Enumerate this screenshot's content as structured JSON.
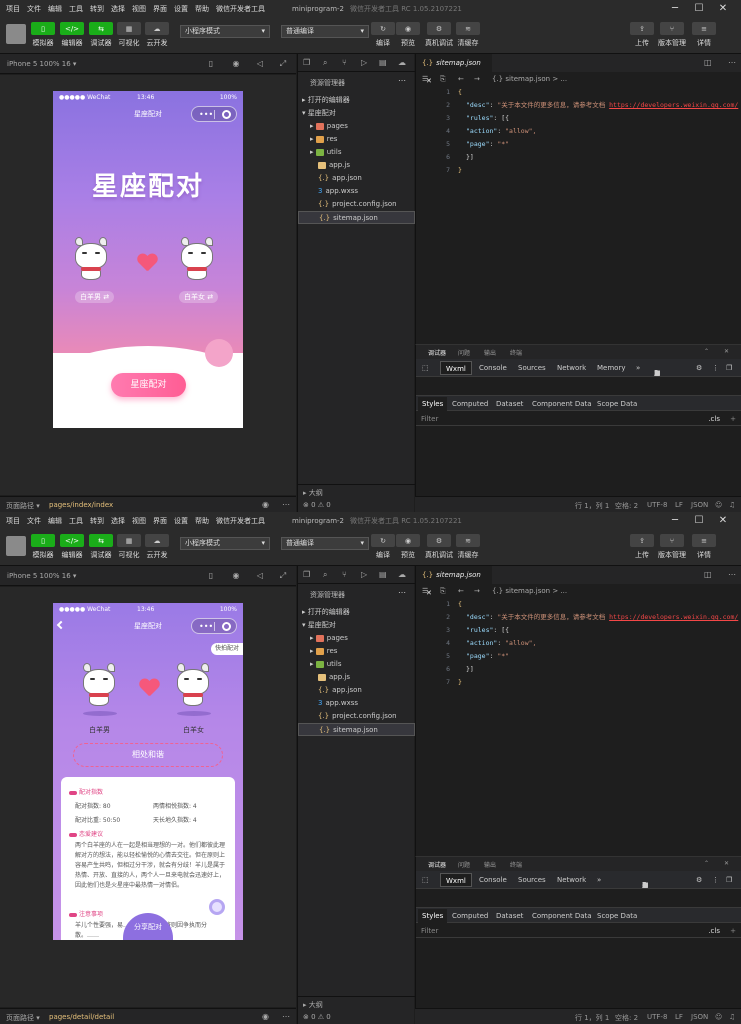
{
  "menu": [
    "项目",
    "文件",
    "编辑",
    "工具",
    "转到",
    "选择",
    "视图",
    "界面",
    "设置",
    "帮助",
    "微信开发者工具"
  ],
  "window": {
    "project": "miniprogram-2",
    "app": "微信开发者工具 RC 1.05.2107221"
  },
  "toolbar": {
    "left": [
      "模拟器",
      "编辑器",
      "调试器",
      "可视化",
      "云开发"
    ],
    "mode_select": "小程序模式",
    "compile_select": "普通编译",
    "mid": [
      "编译",
      "预览",
      "真机调试",
      "清缓存"
    ],
    "right": [
      "上传",
      "版本管理",
      "详情"
    ]
  },
  "simulator": {
    "device_label": "iPhone 5 100% 16 ▾"
  },
  "phone": {
    "carrier": "●●●●● WeChat",
    "time": "13:46",
    "battery": "100%",
    "nav_title": "星座配对",
    "home_title": "星座配对",
    "name_left_home": "白羊男 ⇄",
    "name_right_home": "白羊女 ⇄",
    "match_button": "星座配对",
    "quick_button": "快拍配对",
    "name_left": "白羊男",
    "name_right": "白羊女",
    "relation": "相处和谐",
    "sections": [
      "配对指数",
      "恋爱建议",
      "注意事项"
    ],
    "stats": [
      "配对指数: 80",
      "两情相悦指数: 4",
      "配对比重: 50:50",
      "天长地久指数: 4"
    ],
    "advice": "两个白羊座的人在一起是相当理想的一对。他们都彼此理解对方的想法，能以轻松愉悦的心情去交往。但在原则上容易产生共鸣，但相过分干涉，就会有分歧！羊儿是属于热情、开放、直接的人，两个人一旦来电就会迅速好上，因此他们也是火星座中最热情一对情侣。",
    "caution": "羊儿个性要强，易……所以他俩会将则因争执而分散。……",
    "share_button": "分享配对"
  },
  "footer": {
    "label": "页面路径 ▾",
    "path1": "pages/index/index",
    "path2": "pages/detail/detail"
  },
  "explorer": {
    "header": "资源管理器",
    "open_editors": "打开的编辑器",
    "project": "星座配对",
    "files": [
      "pages",
      "res",
      "utils",
      "app.js",
      "app.json",
      "app.wxss",
      "project.config.json",
      "sitemap.json"
    ],
    "outline": "大纲",
    "problems": "⊗ 0 ⚠ 0"
  },
  "editor": {
    "tab": "sitemap.json",
    "breadcrumb": "{.} sitemap.json > ...",
    "lines": [
      {
        "n": "1",
        "t": "{"
      },
      {
        "n": "2",
        "key": "\"desc\"",
        "val": "\"关于本文件的更多信息，请参考文档 ",
        "url": "https://developers.weixin.qq.com/"
      },
      {
        "n": "3",
        "key": "\"rules\"",
        "rest": ": [{"
      },
      {
        "n": "4",
        "key": "\"action\"",
        "val2": "\"allow\","
      },
      {
        "n": "5",
        "key": "\"page\"",
        "val2": "\"*\""
      },
      {
        "n": "6",
        "t": "}]"
      },
      {
        "n": "7",
        "t": "}"
      }
    ]
  },
  "devtools": {
    "top_tabs": [
      "调试器",
      "问题",
      "输出",
      "终端"
    ],
    "tabs": [
      "Wxml",
      "Console",
      "Sources",
      "Network",
      "Memory"
    ],
    "tabs2": [
      "Wxml",
      "Console",
      "Sources",
      "Network"
    ],
    "badge1_warn": "5",
    "badge1_info": "1",
    "badge2_err": "2",
    "badge2_warn": "7",
    "badge2_info": "1",
    "panel_tabs": [
      "Styles",
      "Computed",
      "Dataset",
      "Component Data",
      "Scope Data"
    ],
    "filter": "Filter",
    "cls": ".cls"
  },
  "status": {
    "pos": "行 1，列 1",
    "spaces": "空格: 2",
    "enc": "UTF-8",
    "eol": "LF",
    "lang": "JSON"
  },
  "colors": {
    "green": "#1aad19",
    "accent_pink": "#ff5d94",
    "purple": "#9a7ae6"
  }
}
